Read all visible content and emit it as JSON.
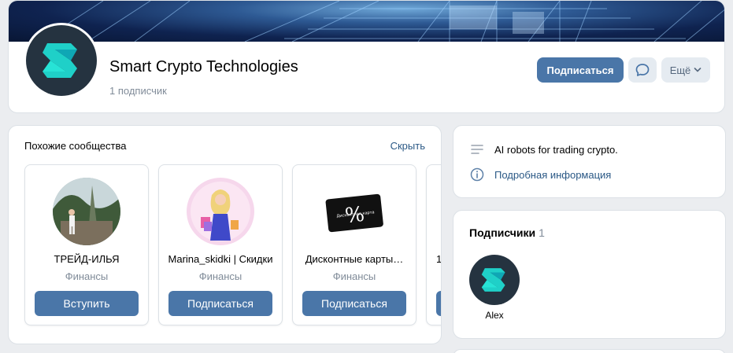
{
  "group": {
    "name": "Smart Crypto Technologies",
    "subscribers": "1 подписчик",
    "subscribe_label": "Подписаться",
    "more_label": "Ещё"
  },
  "similar": {
    "title": "Похожие сообщества",
    "hide_label": "Скрыть",
    "items": [
      {
        "name": "ТРЕЙД-ИЛЬЯ",
        "category": "Финансы",
        "button": "Вступить"
      },
      {
        "name": "Marina_skidki | Скидки",
        "category": "Финансы",
        "button": "Подписаться"
      },
      {
        "name": "Дисконтные карты…",
        "category": "Финансы",
        "button": "Подписаться",
        "avatar_text": "Дисконтная карта"
      },
      {
        "name": "1",
        "category": "",
        "button": ""
      }
    ]
  },
  "info": {
    "description": "AI robots for trading crypto.",
    "details_link": "Подробная информация"
  },
  "members": {
    "title": "Подписчики",
    "count": "1",
    "items": [
      {
        "name": "Alex"
      }
    ]
  },
  "colors": {
    "accent": "#4a76a8",
    "link": "#2a5885",
    "muted": "#818c99",
    "logo_cyan": "#1fd0c8",
    "logo_bg": "#253340"
  }
}
